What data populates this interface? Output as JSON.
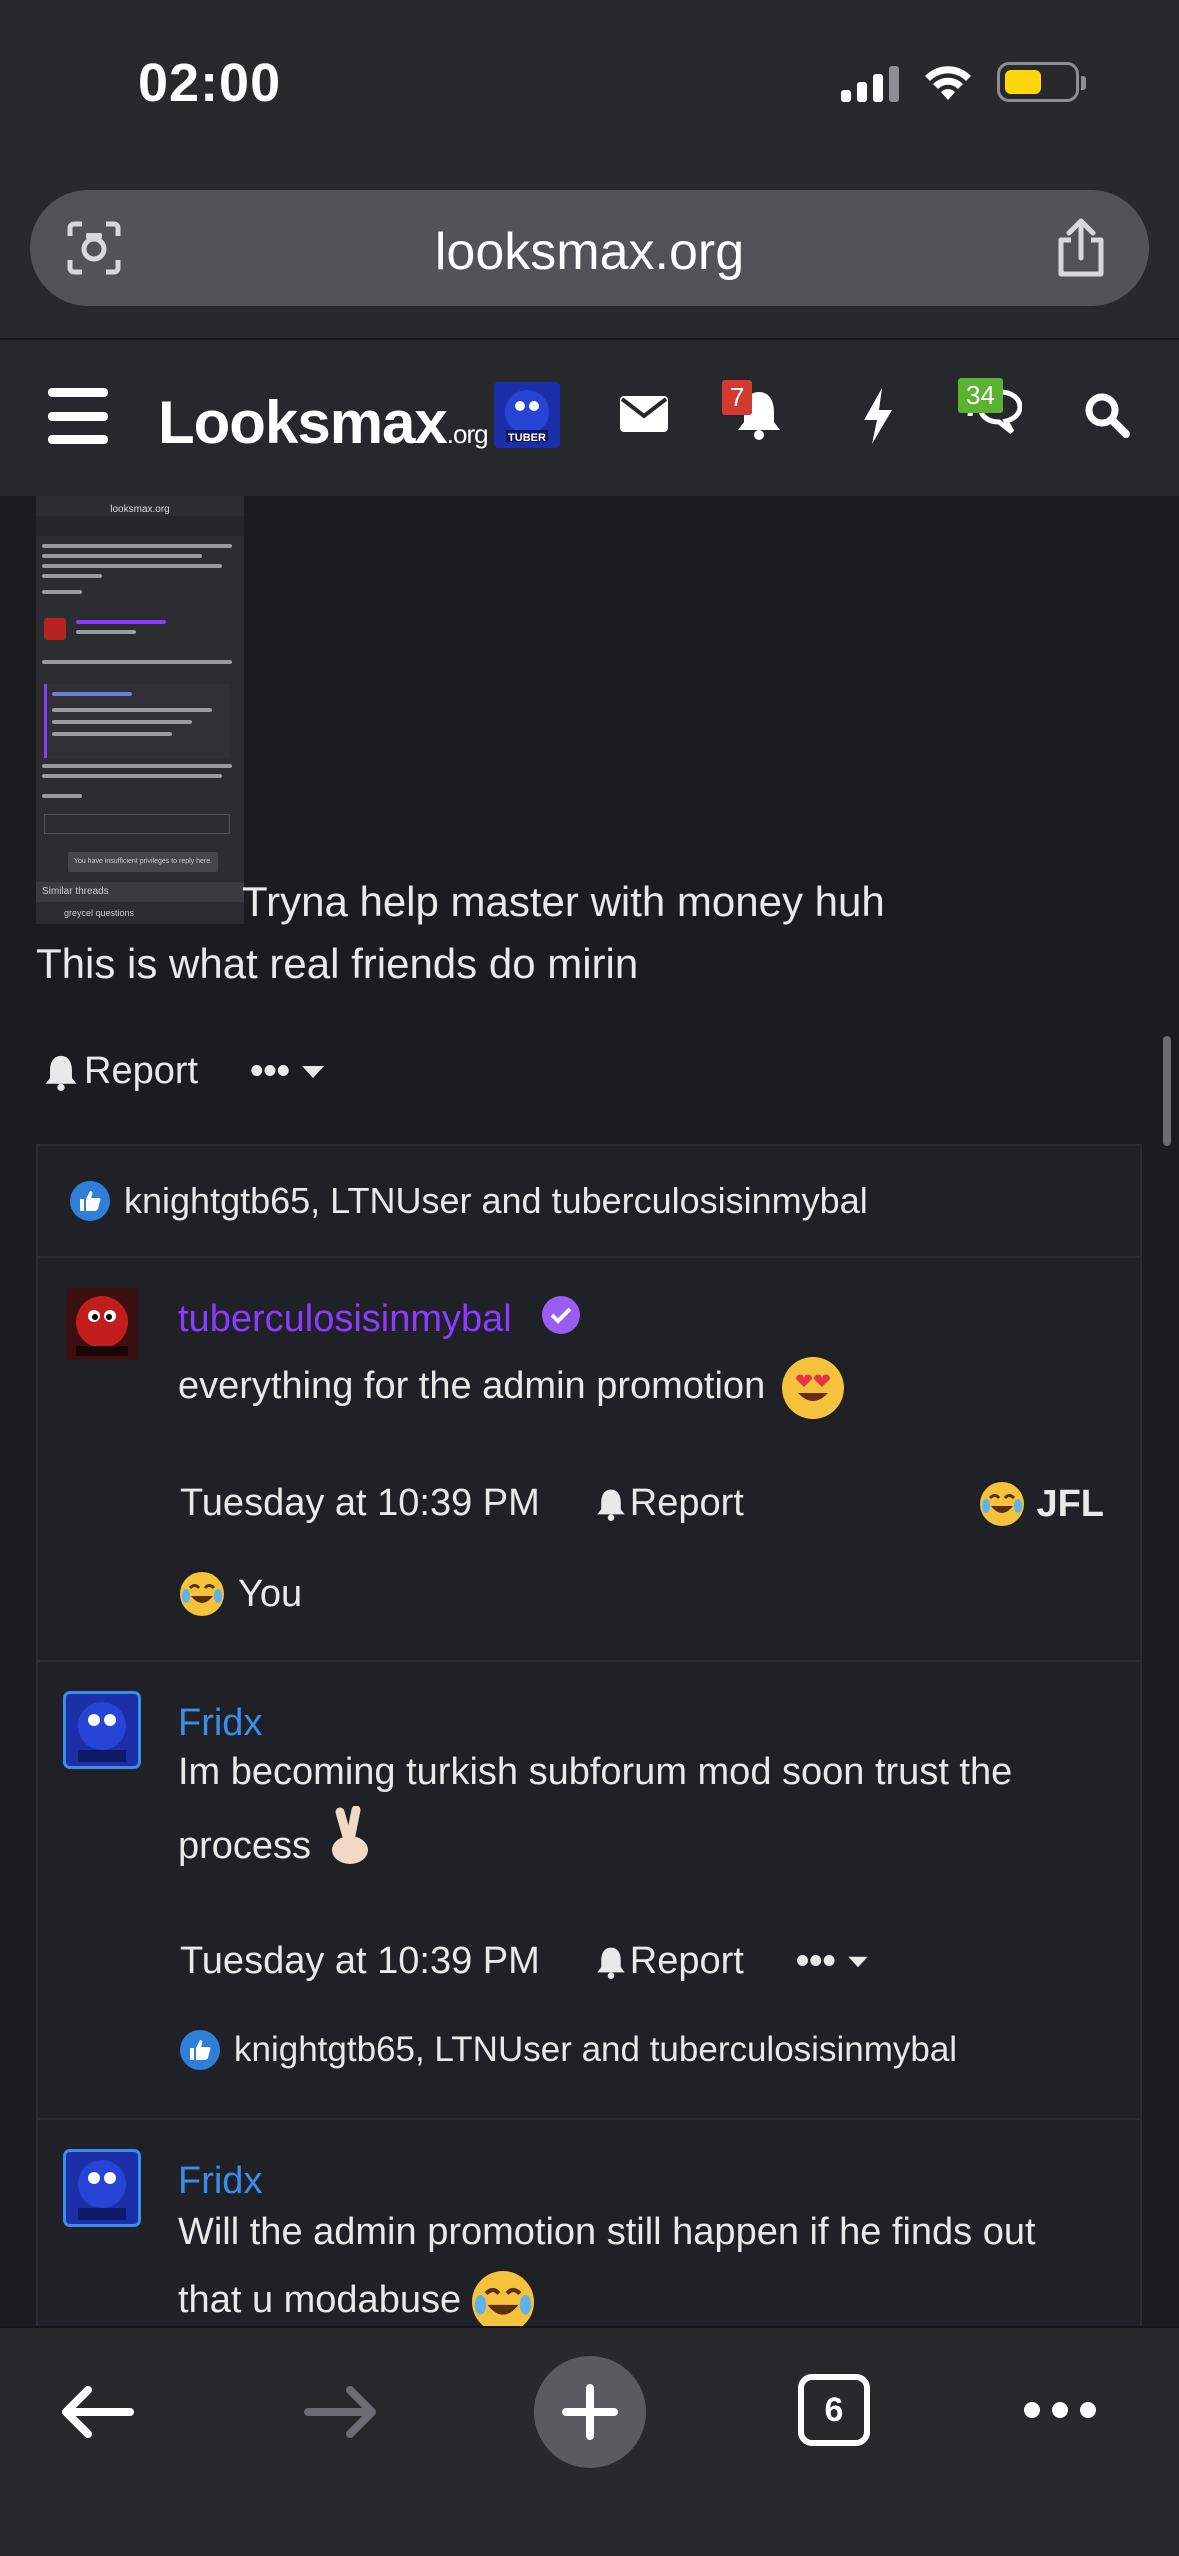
{
  "status_bar": {
    "time": "02:00"
  },
  "browser": {
    "url": "looksmax.org",
    "tab_count": "6"
  },
  "site_nav": {
    "logo_main": "Looksmax",
    "logo_suffix": ".org",
    "alerts_badge": "7",
    "conversations_badge": "34",
    "avatar_label": "TUBER"
  },
  "post": {
    "thumbnail_header": "looksmax.org",
    "thumbnail_similar_threads": "Similar threads",
    "thumbnail_similar_item": "greycel questions",
    "thumbnail_privilege_note": "You have insufficient privileges to reply here.",
    "line1": "Tryna help master with money huh",
    "line2": "This is what real friends do mirin",
    "report_label": "Report",
    "more_label": "•••"
  },
  "reactions_summary": "knightgtb65, LTNUser and tuberculosisinmybal",
  "comments": [
    {
      "author": "tuberculosisinmybal",
      "author_color": "#8a3cff",
      "text": "everything for the admin promotion",
      "timestamp": "Tuesday at 10:39 PM",
      "report": "Report",
      "reaction_label": "JFL",
      "reacted_by": "You"
    },
    {
      "author": "Fridx",
      "author_color": "#3b8de8",
      "text_line1": "Im becoming turkish subforum mod soon trust the",
      "text_line2": "process",
      "timestamp": "Tuesday at 10:39 PM",
      "report": "Report",
      "more": "•••",
      "reactions": "knightgtb65, LTNUser and tuberculosisinmybal"
    },
    {
      "author": "Fridx",
      "author_color": "#3b8de8",
      "text_line1": "Will the admin promotion still happen if he finds out",
      "text_line2": "that u modabuse"
    }
  ],
  "colors": {
    "page_bg": "#1b1c20",
    "nav_bg": "#27282c",
    "alert_badge": "#d23b30",
    "conv_badge": "#5ab330",
    "like_blue": "#2f7fd8"
  }
}
